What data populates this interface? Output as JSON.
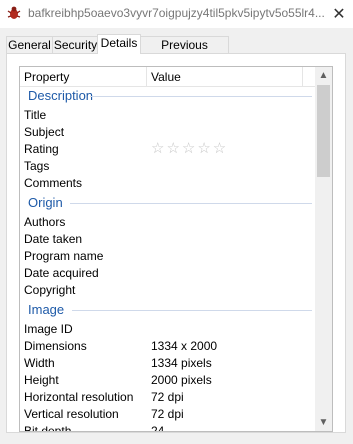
{
  "window": {
    "title": "bafkreibhp5oaevo3vyvr7oigpujzy4til5pkv5ipytv5o55lr4...",
    "close_glyph": "✕"
  },
  "tabs": [
    {
      "label": "General"
    },
    {
      "label": "Security"
    },
    {
      "label": "Details",
      "active": true
    },
    {
      "label": "Previous Versions"
    }
  ],
  "columns": {
    "property": "Property",
    "value": "Value"
  },
  "groups": {
    "description": "Description",
    "origin": "Origin",
    "image": "Image"
  },
  "properties": {
    "title": {
      "label": "Title",
      "value": ""
    },
    "subject": {
      "label": "Subject",
      "value": ""
    },
    "rating": {
      "label": "Rating",
      "stars": "☆☆☆☆☆"
    },
    "tags": {
      "label": "Tags",
      "value": ""
    },
    "comments": {
      "label": "Comments",
      "value": ""
    },
    "authors": {
      "label": "Authors",
      "value": ""
    },
    "date_taken": {
      "label": "Date taken",
      "value": ""
    },
    "program_name": {
      "label": "Program name",
      "value": ""
    },
    "date_acquired": {
      "label": "Date acquired",
      "value": ""
    },
    "copyright": {
      "label": "Copyright",
      "value": ""
    },
    "image_id": {
      "label": "Image ID",
      "value": ""
    },
    "dimensions": {
      "label": "Dimensions",
      "value": "1334 x 2000"
    },
    "width": {
      "label": "Width",
      "value": "1334 pixels"
    },
    "height": {
      "label": "Height",
      "value": "2000 pixels"
    },
    "horizontal_resolution": {
      "label": "Horizontal resolution",
      "value": "72 dpi"
    },
    "vertical_resolution": {
      "label": "Vertical resolution",
      "value": "72 dpi"
    },
    "bit_depth": {
      "label": "Bit depth",
      "value": "24"
    }
  },
  "scrollbar": {
    "up_glyph": "▲",
    "down_glyph": "▼"
  },
  "colors": {
    "group_heading": "#1e5aa8"
  }
}
